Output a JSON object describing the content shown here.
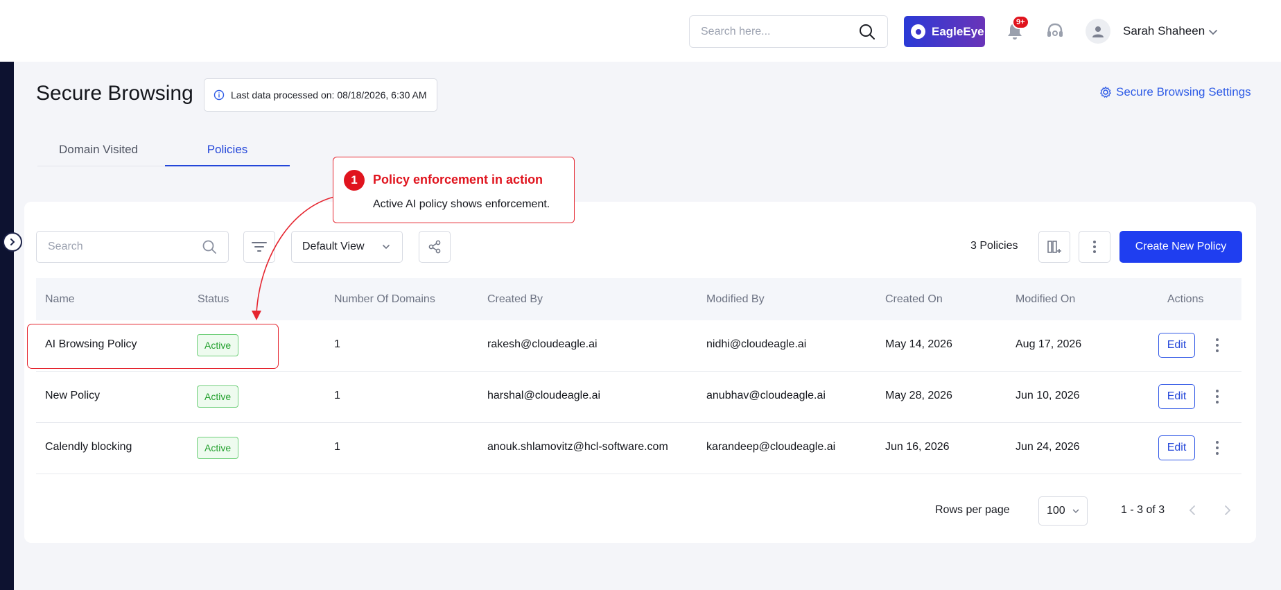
{
  "header": {
    "search_placeholder": "Search here...",
    "brand_label": "EagleEye",
    "notifications_badge": "9+",
    "user_name": "Sarah Shaheen"
  },
  "page": {
    "title": "Secure Browsing",
    "last_processed": "Last data processed on: 08/18/2026, 6:30 AM",
    "settings_label": "Secure Browsing Settings",
    "tabs": [
      {
        "label": "Domain Visited",
        "active": false
      },
      {
        "label": "Policies",
        "active": true
      }
    ]
  },
  "toolbar": {
    "search_placeholder": "Search",
    "view_label": "Default View",
    "policy_count": "3 Policies",
    "create_label": "Create New Policy"
  },
  "table": {
    "columns": [
      "Name",
      "Status",
      "Number Of Domains",
      "Created By",
      "Modified By",
      "Created On",
      "Modified On",
      "Actions"
    ],
    "rows": [
      {
        "name": "AI Browsing Policy",
        "status": "Active",
        "domains": "1",
        "created_by": "rakesh@cloudeagle.ai",
        "modified_by": "nidhi@cloudeagle.ai",
        "created_on": "May 14, 2026",
        "modified_on": "Aug 17, 2026",
        "action": "Edit"
      },
      {
        "name": "New Policy",
        "status": "Active",
        "domains": "1",
        "created_by": "harshal@cloudeagle.ai",
        "modified_by": "anubhav@cloudeagle.ai",
        "created_on": "May 28, 2026",
        "modified_on": "Jun 10, 2026",
        "action": "Edit"
      },
      {
        "name": "Calendly blocking",
        "status": "Active",
        "domains": "1",
        "created_by": "anouk.shlamovitz@hcl-software.com",
        "modified_by": "karandeep@cloudeagle.ai",
        "created_on": "Jun 16, 2026",
        "modified_on": "Jun 24, 2026",
        "action": "Edit"
      }
    ]
  },
  "pagination": {
    "rows_label": "Rows per page",
    "rows_value": "100",
    "range": "1 - 3 of 3"
  },
  "callout": {
    "number": "1",
    "title": "Policy enforcement in action",
    "body": "Active AI policy shows enforcement."
  },
  "colors": {
    "primary": "#1f3ef0",
    "accent_link": "#2f5ce6",
    "annotation_red": "#e0141e",
    "active_green": "#22a02d"
  }
}
